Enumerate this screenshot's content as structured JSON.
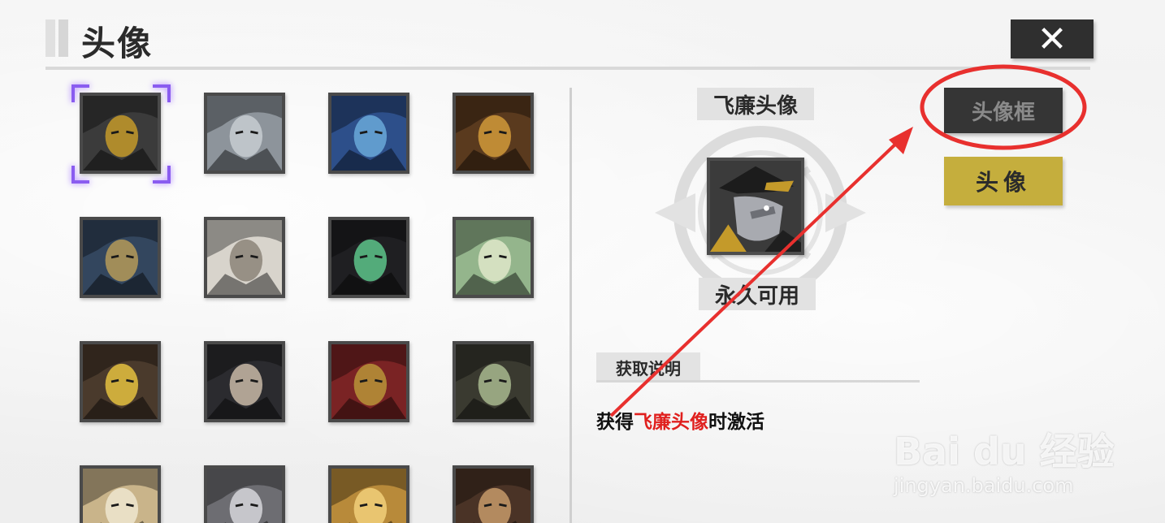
{
  "header": {
    "title": "头像",
    "close_label": "✕"
  },
  "avatars": [
    {
      "tone": "#3b3b3b",
      "accent": "#c49a2a"
    },
    {
      "tone": "#8d949b",
      "accent": "#c7ccd1"
    },
    {
      "tone": "#2d4f8a",
      "accent": "#6aa8d8"
    },
    {
      "tone": "#5a3a1e",
      "accent": "#d19a3a"
    },
    {
      "tone": "#33465e",
      "accent": "#b59a58"
    },
    {
      "tone": "#d8d4cc",
      "accent": "#8c8478"
    },
    {
      "tone": "#1f1f22",
      "accent": "#5dc48a"
    },
    {
      "tone": "#94b58c",
      "accent": "#dfe7c9"
    },
    {
      "tone": "#4a3a2c",
      "accent": "#e4c140"
    },
    {
      "tone": "#2b2b2f",
      "accent": "#c8b8a6"
    },
    {
      "tone": "#7a2324",
      "accent": "#b89438"
    },
    {
      "tone": "#3a3a30",
      "accent": "#a8b88e"
    },
    {
      "tone": "#c9b48a",
      "accent": "#efe6cf"
    },
    {
      "tone": "#6d6d72",
      "accent": "#d6d6da"
    },
    {
      "tone": "#b88a3a",
      "accent": "#f1cf7a"
    },
    {
      "tone": "#4a3326",
      "accent": "#c59a6a"
    }
  ],
  "detail": {
    "avatar_name": "飞廉头像",
    "availability": "永久可用",
    "section_title": "获取说明",
    "acquire_prefix": "获得",
    "acquire_highlight": "飞廉头像",
    "acquire_suffix": "时激活"
  },
  "side_tabs": {
    "frame_label": "头像框",
    "avatar_label": "头像"
  },
  "colors": {
    "selection": "#8a5cf0",
    "accent_gold": "#c5ae3d",
    "highlight_red": "#e0201e",
    "annotation_red": "#e8302e"
  },
  "watermark": {
    "main": "Bai du 经验",
    "sub": "jingyan.baidu.com"
  }
}
